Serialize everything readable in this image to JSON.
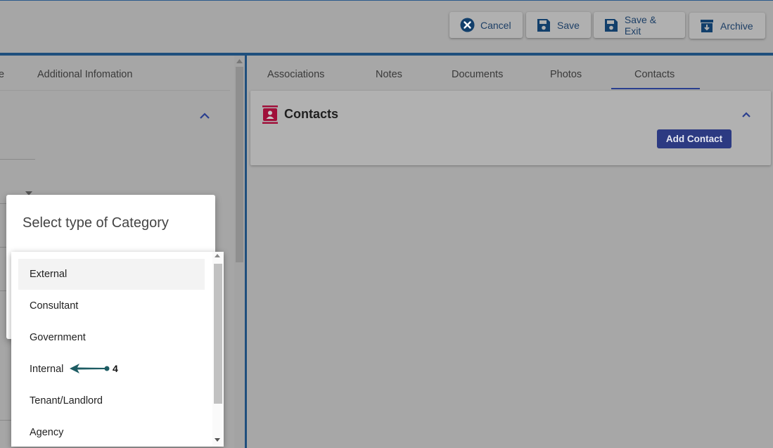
{
  "toolbar": {
    "cancel_label": "Cancel",
    "save_label": "Save",
    "save_exit_label": "Save & Exit",
    "archive_label": "Archive"
  },
  "left_panel": {
    "tabs": [
      {
        "label": "e"
      },
      {
        "label": "Additional Infomation"
      }
    ]
  },
  "right_panel": {
    "tabs": [
      {
        "label": "Associations"
      },
      {
        "label": "Notes"
      },
      {
        "label": "Documents"
      },
      {
        "label": "Photos"
      },
      {
        "label": "Contacts",
        "active": true
      }
    ],
    "contacts_section": {
      "title": "Contacts",
      "add_button_label": "Add Contact"
    }
  },
  "dialog": {
    "title": "Select type of Category",
    "options": [
      {
        "label": "External",
        "highlighted": true
      },
      {
        "label": "Consultant"
      },
      {
        "label": "Government"
      },
      {
        "label": "Internal"
      },
      {
        "label": "Tenant/Landlord"
      },
      {
        "label": "Agency"
      }
    ]
  },
  "annotation": {
    "number": "4",
    "color": "#1d5c63"
  },
  "colors": {
    "accent": "#1f4f7d",
    "add_button": "#2c3a82",
    "contacts_icon": "#a0103a"
  }
}
